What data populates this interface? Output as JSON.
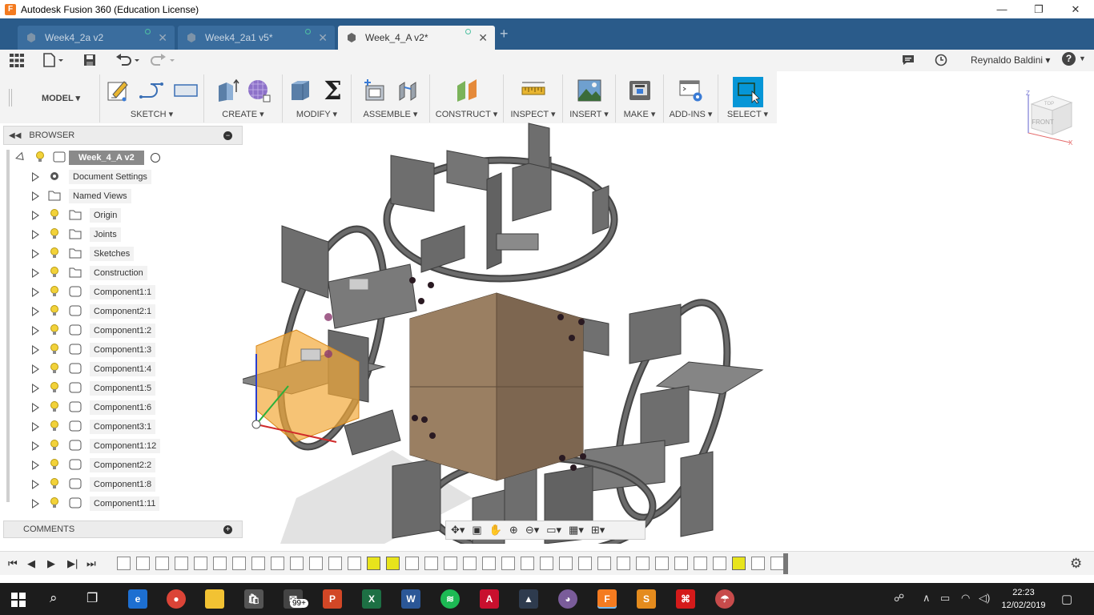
{
  "window": {
    "title": "Autodesk Fusion 360 (Education License)",
    "controls": [
      "—",
      "❐",
      "✕"
    ]
  },
  "tabs": [
    {
      "label": "Week4_2a v2",
      "active": false
    },
    {
      "label": "Week4_2a1 v5*",
      "active": false
    },
    {
      "label": "Week_4_A v2*",
      "active": true
    }
  ],
  "qat": {
    "user": "Reynaldo Baldini ▾",
    "help": "?"
  },
  "ribbon": {
    "workspace": "MODEL ▾",
    "groups": [
      {
        "label": "SKETCH ▾"
      },
      {
        "label": "CREATE ▾"
      },
      {
        "label": "MODIFY ▾"
      },
      {
        "label": "ASSEMBLE ▾"
      },
      {
        "label": "CONSTRUCT ▾"
      },
      {
        "label": "INSPECT ▾"
      },
      {
        "label": "INSERT ▾"
      },
      {
        "label": "MAKE ▾"
      },
      {
        "label": "ADD-INS ▾"
      },
      {
        "label": "SELECT ▾"
      }
    ]
  },
  "viewcube": {
    "top": "TOP",
    "front": "FRONT",
    "z": "Z",
    "x": "X"
  },
  "browser": {
    "title": "BROWSER",
    "root": "Week_4_A v2",
    "items": [
      {
        "label": "Document Settings",
        "icon": "gear-icon"
      },
      {
        "label": "Named Views",
        "icon": "folder-icon"
      },
      {
        "label": "Origin",
        "icon": "folder-icon"
      },
      {
        "label": "Joints",
        "icon": "folder-icon"
      },
      {
        "label": "Sketches",
        "icon": "folder-icon"
      },
      {
        "label": "Construction",
        "icon": "folder-icon"
      },
      {
        "label": "Component1:1",
        "icon": "component-icon"
      },
      {
        "label": "Component2:1",
        "icon": "component-icon"
      },
      {
        "label": "Component1:2",
        "icon": "component-icon"
      },
      {
        "label": "Component1:3",
        "icon": "component-icon"
      },
      {
        "label": "Component1:4",
        "icon": "component-icon"
      },
      {
        "label": "Component1:5",
        "icon": "component-icon"
      },
      {
        "label": "Component1:6",
        "icon": "component-icon"
      },
      {
        "label": "Component3:1",
        "icon": "component-icon"
      },
      {
        "label": "Component1:12",
        "icon": "component-icon"
      },
      {
        "label": "Component2:2",
        "icon": "component-icon"
      },
      {
        "label": "Component1:8",
        "icon": "component-icon"
      },
      {
        "label": "Component1:11",
        "icon": "component-icon"
      }
    ]
  },
  "comments": {
    "title": "COMMENTS"
  },
  "taskbar": {
    "clock_time": "22:23",
    "clock_date": "12/02/2019",
    "badge": "99+"
  },
  "colors": {
    "tabbar": "#2a5b8a",
    "select_accent": "#0696d7",
    "timeline_highlight": "#e8e41c",
    "model_plate": "#6e6e6e"
  }
}
